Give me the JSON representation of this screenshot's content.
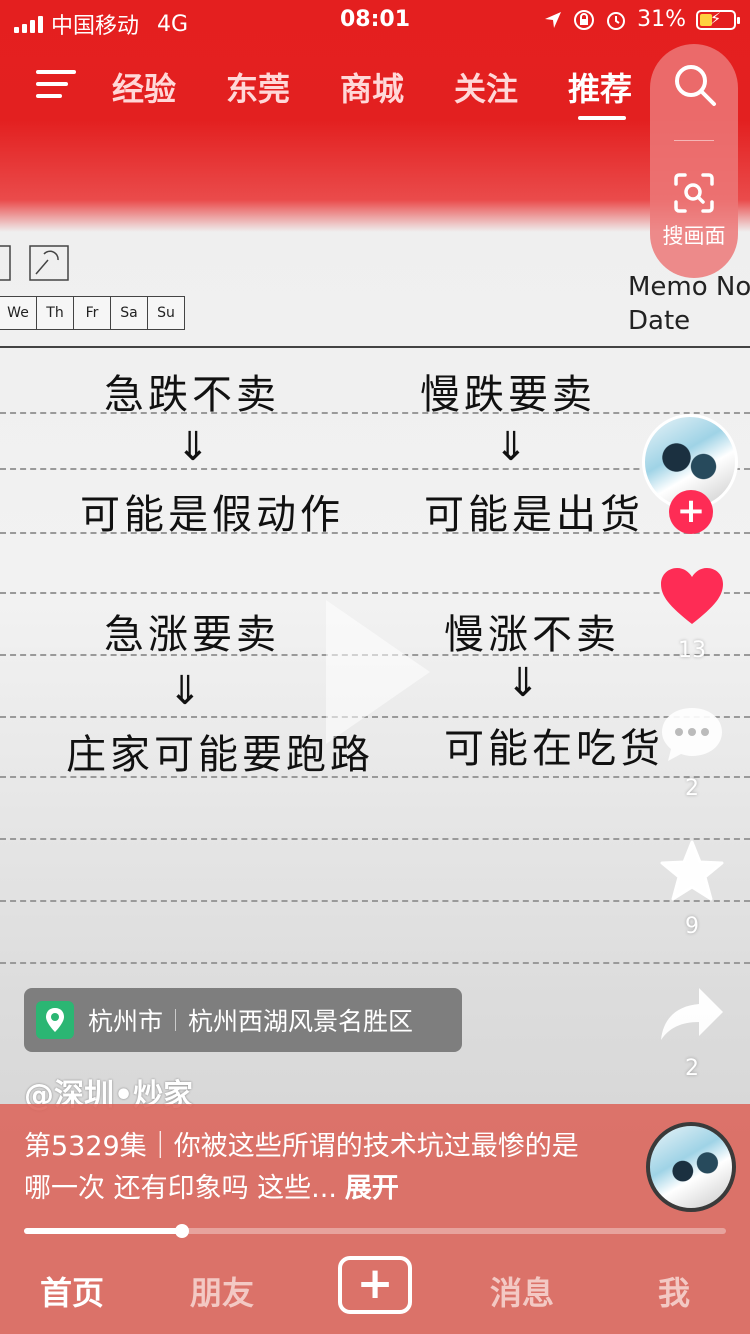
{
  "status_bar": {
    "carrier": "中国移动",
    "network": "4G",
    "time": "08:01",
    "battery": "31%"
  },
  "top_nav": {
    "tabs": [
      "经验",
      "东莞",
      "商城",
      "关注",
      "推荐"
    ],
    "active_tab": "推荐",
    "search_label": "搜画面"
  },
  "paper": {
    "weekdays": [
      "We",
      "Th",
      "Fr",
      "Sa",
      "Su"
    ],
    "memo_label": "Memo No",
    "date_label": "Date",
    "arrow": "⇓",
    "lines": {
      "l1": "急跌不卖",
      "l2": "可能是假动作",
      "r1": "慢跌要卖",
      "r2": "可能是出货",
      "l3": "急涨要卖",
      "l4": "庄家可能要跑路",
      "r3": "慢涨不卖",
      "r4": "可能在吃货"
    }
  },
  "actions": {
    "likes": "13",
    "comments": "2",
    "favorites": "9",
    "shares": "2"
  },
  "location": {
    "city": "杭州市",
    "place": "杭州西湖风景名胜区"
  },
  "video": {
    "author": "@深圳•炒家",
    "caption": "第5329集｜你被这些所谓的技术坑过最惨的是哪一次 还有印象吗 这些...",
    "expand": "展开",
    "progress": 0.225
  },
  "bottom_nav": {
    "home": "首页",
    "friends": "朋友",
    "messages": "消息",
    "me": "我"
  },
  "colors": {
    "brand_red": "#e41f1f",
    "like_red": "#fe2c55",
    "location_green": "#2bb673"
  }
}
